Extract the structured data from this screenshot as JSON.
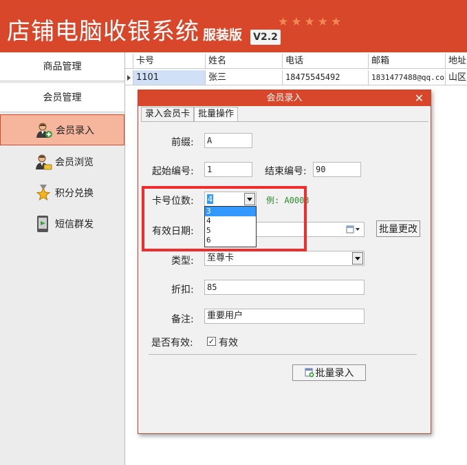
{
  "header": {
    "title": "店铺电脑收银系统",
    "edition": "服装版",
    "version": "V2.2",
    "stars": [
      "★",
      "★",
      "★",
      "★",
      "★"
    ]
  },
  "sidebar": {
    "groups": [
      {
        "label": "商品管理"
      },
      {
        "label": "会员管理"
      }
    ],
    "items": [
      {
        "label": "会员录入",
        "icon": "member-add-icon",
        "active": true
      },
      {
        "label": "会员浏览",
        "icon": "member-vip-icon",
        "active": false
      },
      {
        "label": "积分兑换",
        "icon": "star-medal-icon",
        "active": false
      },
      {
        "label": "短信群发",
        "icon": "sms-phone-icon",
        "active": false
      }
    ]
  },
  "grid": {
    "columns": [
      "卡号",
      "姓名",
      "电话",
      "邮箱",
      "地址"
    ],
    "rows": [
      [
        "1101",
        "张三",
        "18475545492",
        "1831477488@qq.co",
        "山区"
      ]
    ]
  },
  "dialog": {
    "title": "会员录入",
    "close": "✕",
    "tabs": [
      {
        "label": "录入会员卡",
        "active": false
      },
      {
        "label": "批量操作",
        "active": true
      }
    ],
    "form": {
      "prefix_label": "前缀:",
      "prefix_value": "A",
      "start_label": "起始编号:",
      "start_value": "1",
      "end_label": "结束编号:",
      "end_value": "90",
      "digits_label": "卡号位数:",
      "digits_value": "4",
      "digits_hint": "例: A0003",
      "digits_options": [
        "3",
        "4",
        "5",
        "6"
      ],
      "digits_highlighted": "3",
      "expiry_label": "有效日期:",
      "expiry_value": "",
      "batch_change_label": "批量更改",
      "type_label": "类型:",
      "type_value": "至尊卡",
      "discount_label": "折扣:",
      "discount_value": "85",
      "note_label": "备注:",
      "note_value": "重要用户",
      "valid_label": "是否有效:",
      "valid_checkbox_label": "有效",
      "valid_checked": true,
      "submit_label": "批量录入"
    }
  },
  "colors": {
    "brand": "#d9472b",
    "active_nav": "#f5b69d",
    "highlight_box": "#ef2d2d",
    "hint": "#2a8a2a",
    "selection": "#3399ff"
  }
}
